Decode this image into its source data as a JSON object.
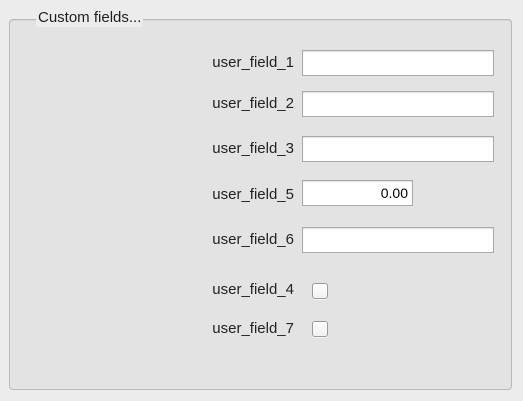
{
  "group": {
    "title": "Custom fields..."
  },
  "fields": [
    {
      "label": "user_field_1",
      "value": ""
    },
    {
      "label": "user_field_2",
      "value": ""
    },
    {
      "label": "user_field_3",
      "value": ""
    },
    {
      "label": "user_field_5",
      "value": "0.00"
    },
    {
      "label": "user_field_6",
      "value": ""
    }
  ],
  "checkboxes": [
    {
      "label": "user_field_4",
      "checked": false
    },
    {
      "label": "user_field_7",
      "checked": false
    }
  ]
}
